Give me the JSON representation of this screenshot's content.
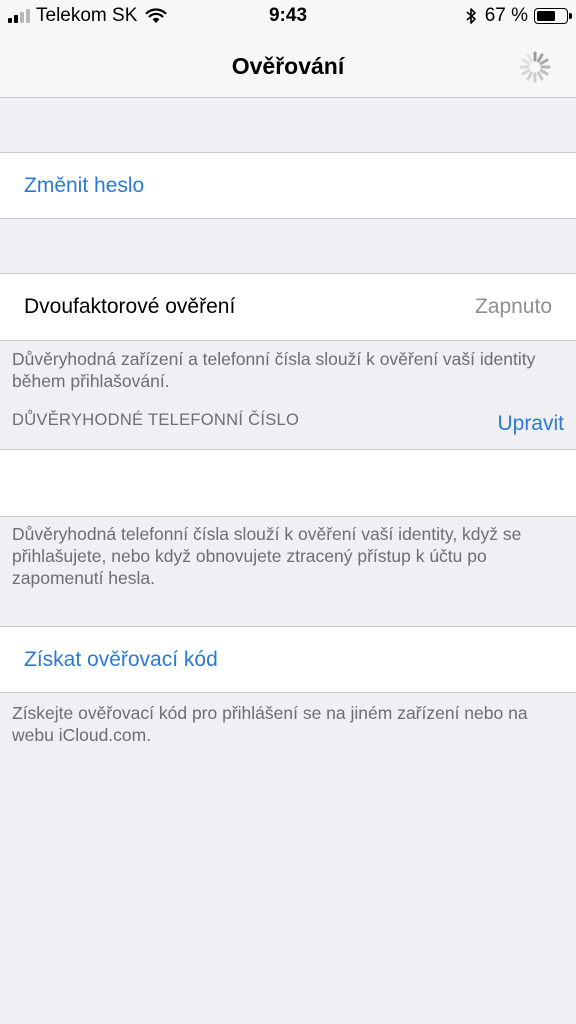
{
  "status_bar": {
    "carrier": "Telekom SK",
    "time": "9:43",
    "battery_percent": "67 %",
    "battery_level": 0.67,
    "icons": [
      "signal-icon",
      "wifi-icon",
      "bluetooth-icon",
      "battery-icon"
    ]
  },
  "nav": {
    "title": "Ověřování"
  },
  "change_password": {
    "label": "Změnit heslo"
  },
  "two_factor": {
    "label": "Dvoufaktorové ověření",
    "value": "Zapnuto",
    "footer": "Důvěryhodná zařízení a telefonní čísla slouží k ověření vaší identity během přihlašování."
  },
  "trusted_phone": {
    "header": "DŮVĚRYHODNÉ TELEFONNÍ ČÍSLO",
    "edit_label": "Upravit",
    "number": "",
    "footer": "Důvěryhodná telefonní čísla slouží k ověření vaší identity, když se přihlašujete, nebo když obnovujete ztracený přístup k účtu po zapomenutí hesla."
  },
  "verification_code": {
    "label": "Získat ověřovací kód",
    "footer": "Získejte ověřovací kód pro přihlášení se na jiném zařízení nebo na webu iCloud.com."
  },
  "colors": {
    "link": "#2b79d7",
    "background": "#efeff4",
    "secondary_text": "#6d6d72"
  }
}
